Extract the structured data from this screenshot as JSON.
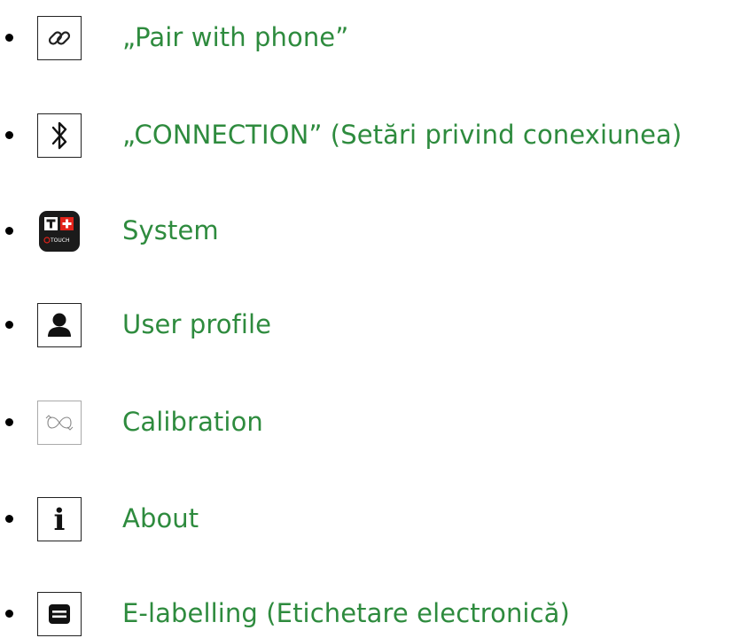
{
  "theme": {
    "label_color": "#2e8b3e",
    "bullet_color": "#000000"
  },
  "menu": {
    "items": [
      {
        "icon": "link-icon",
        "label": "„Pair with phone”"
      },
      {
        "icon": "bluetooth-icon",
        "label": "„CONNECTION” (Setări privind conexiunea)"
      },
      {
        "icon": "t-touch-app-icon",
        "label": "System",
        "icon_text": "TOUCH"
      },
      {
        "icon": "user-profile-icon",
        "label": "User profile"
      },
      {
        "icon": "calibration-icon",
        "label": "Calibration"
      },
      {
        "icon": "info-icon",
        "label": "About",
        "icon_text": "i"
      },
      {
        "icon": "e-label-icon",
        "label": "E-labelling (Etichetare electronică)"
      }
    ]
  }
}
